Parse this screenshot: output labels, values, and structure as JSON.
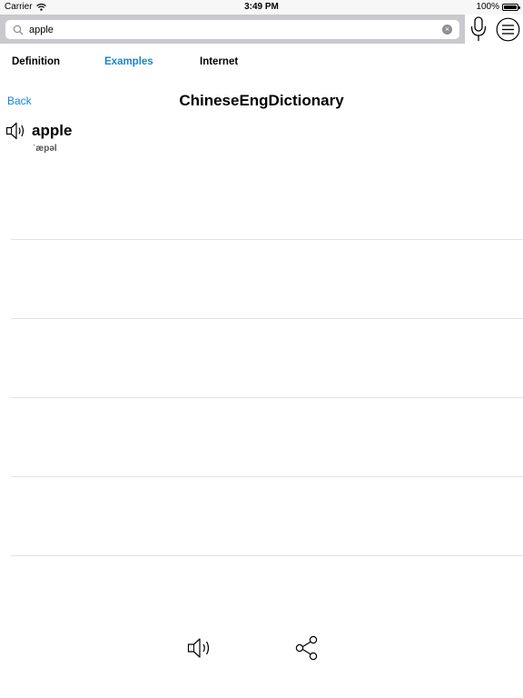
{
  "status_bar": {
    "carrier": "Carrier",
    "time": "3:49 PM",
    "battery": "100%"
  },
  "search": {
    "value": "apple"
  },
  "tabs": [
    {
      "label": "Definition",
      "active": false
    },
    {
      "label": "Examples",
      "active": true
    },
    {
      "label": "Internet",
      "active": false
    }
  ],
  "nav": {
    "back_label": "Back",
    "title": "ChineseEngDictionary"
  },
  "entry": {
    "word": "apple",
    "phonetic": "ˈæpəl"
  },
  "colors": {
    "accent": "#1a84cf",
    "search_bar_bg": "#c9c9ce",
    "divider": "#e2e2e2"
  },
  "icons": [
    "wifi-icon",
    "battery-icon",
    "search-icon",
    "clear-icon",
    "microphone-icon",
    "menu-icon",
    "speaker-icon",
    "share-icon"
  ]
}
